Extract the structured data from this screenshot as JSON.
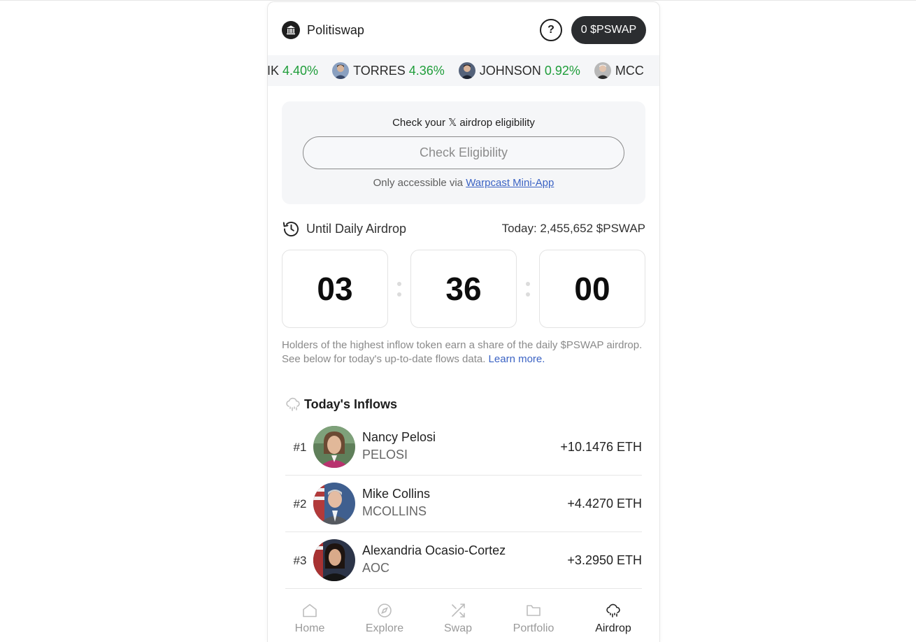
{
  "header": {
    "brand_name": "Politiswap",
    "brand_icon": "capitol-building-icon",
    "help_label": "?",
    "token_balance": "0 $PSWAP"
  },
  "ticker": [
    {
      "name": "NIK",
      "change": "4.40%",
      "avatar": "none"
    },
    {
      "name": "TORRES",
      "change": "4.36%",
      "avatar": "person-photo"
    },
    {
      "name": "JOHNSON",
      "change": "0.92%",
      "avatar": "person-photo"
    },
    {
      "name": "MCC",
      "change": "",
      "avatar": "person-photo"
    }
  ],
  "eligibility": {
    "title": "Check your 𝕏 airdrop eligibility",
    "button_label": "Check Eligibility",
    "note_prefix": "Only accessible via",
    "note_link": "Warpcast Mini-App"
  },
  "countdown": {
    "label": "Until Daily Airdrop",
    "today": "Today: 2,455,652 $PSWAP",
    "hours": "03",
    "minutes": "36",
    "seconds": "00"
  },
  "info": {
    "text": "Holders of the highest inflow token earn a share of the daily $PSWAP airdrop. See below for today's up-to-date flows data.",
    "link": "Learn more."
  },
  "inflows": {
    "title": "Today's Inflows",
    "rows": [
      {
        "rank": "#1",
        "name": "Nancy Pelosi",
        "symbol": "PELOSI",
        "value": "+10.1476 ETH"
      },
      {
        "rank": "#2",
        "name": "Mike Collins",
        "symbol": "MCOLLINS",
        "value": "+4.4270 ETH"
      },
      {
        "rank": "#3",
        "name": "Alexandria Ocasio-Cortez",
        "symbol": "AOC",
        "value": "+3.2950 ETH"
      }
    ]
  },
  "nav": [
    {
      "label": "Home",
      "icon": "home-icon",
      "active": false
    },
    {
      "label": "Explore",
      "icon": "compass-icon",
      "active": false
    },
    {
      "label": "Swap",
      "icon": "shuffle-icon",
      "active": false
    },
    {
      "label": "Portfolio",
      "icon": "folder-icon",
      "active": false
    },
    {
      "label": "Airdrop",
      "icon": "cloud-rain-icon",
      "active": true
    }
  ],
  "colors": {
    "positive": "#1f9d3a",
    "link": "#3b63c4",
    "dark_button": "#2b2d30",
    "panel": "#f5f6f8"
  }
}
